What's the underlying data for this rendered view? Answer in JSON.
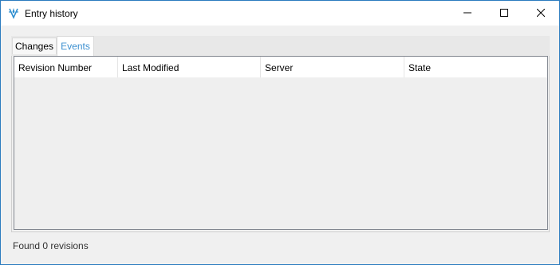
{
  "window": {
    "title": "Entry history",
    "app_icon": "app-logo-icon",
    "controls": {
      "minimize": "minimize-icon",
      "maximize": "maximize-icon",
      "close": "close-icon"
    }
  },
  "tabs": [
    {
      "label": "Changes",
      "selected": false
    },
    {
      "label": "Events",
      "selected": true
    }
  ],
  "grid": {
    "columns": [
      "Revision Number",
      "Last Modified",
      "Server",
      "State"
    ],
    "rows": []
  },
  "status": {
    "text": "Found 0 revisions"
  },
  "colors": {
    "accent": "#3b8fd0",
    "window_border": "#2b7bbf"
  }
}
